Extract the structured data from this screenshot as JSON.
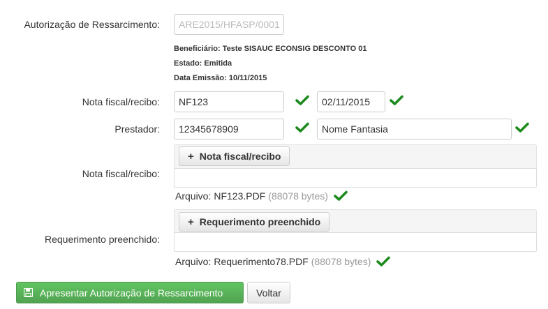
{
  "authorization": {
    "label": "Autorização de Ressarcimento:",
    "value": "ARE2015/HFASP/0001"
  },
  "info": {
    "beneficiario": "Beneficiário: Teste SISAUC ECONSIG DESCONTO 01",
    "estado": "Estado: Emitida",
    "data_emissao": "Data Emissão: 10/11/2015"
  },
  "nota_fiscal": {
    "label": "Nota fiscal/recibo:",
    "number": "NF123",
    "date": "02/11/2015"
  },
  "prestador": {
    "label": "Prestador:",
    "document": "12345678909",
    "name": "Nome Fantasia"
  },
  "upload_nota": {
    "label": "Nota fiscal/recibo:",
    "button": "Nota fiscal/recibo",
    "file_prefix": "Arquivo:",
    "file_name": "NF123.PDF",
    "file_size": "(88078 bytes)"
  },
  "upload_requerimento": {
    "label": "Requerimento preenchido:",
    "button": "Requerimento preenchido",
    "file_prefix": "Arquivo:",
    "file_name": "Requerimento78.PDF",
    "file_size": "(88078 bytes)"
  },
  "actions": {
    "submit": "Apresentar Autorização de Ressarcimento",
    "back": "Voltar"
  },
  "colors": {
    "check": "#1e8a1e",
    "submit_bg": "#5bb75b"
  },
  "icons": {
    "check": "check-icon",
    "plus": "plus-icon",
    "save": "floppy-disk-icon"
  }
}
